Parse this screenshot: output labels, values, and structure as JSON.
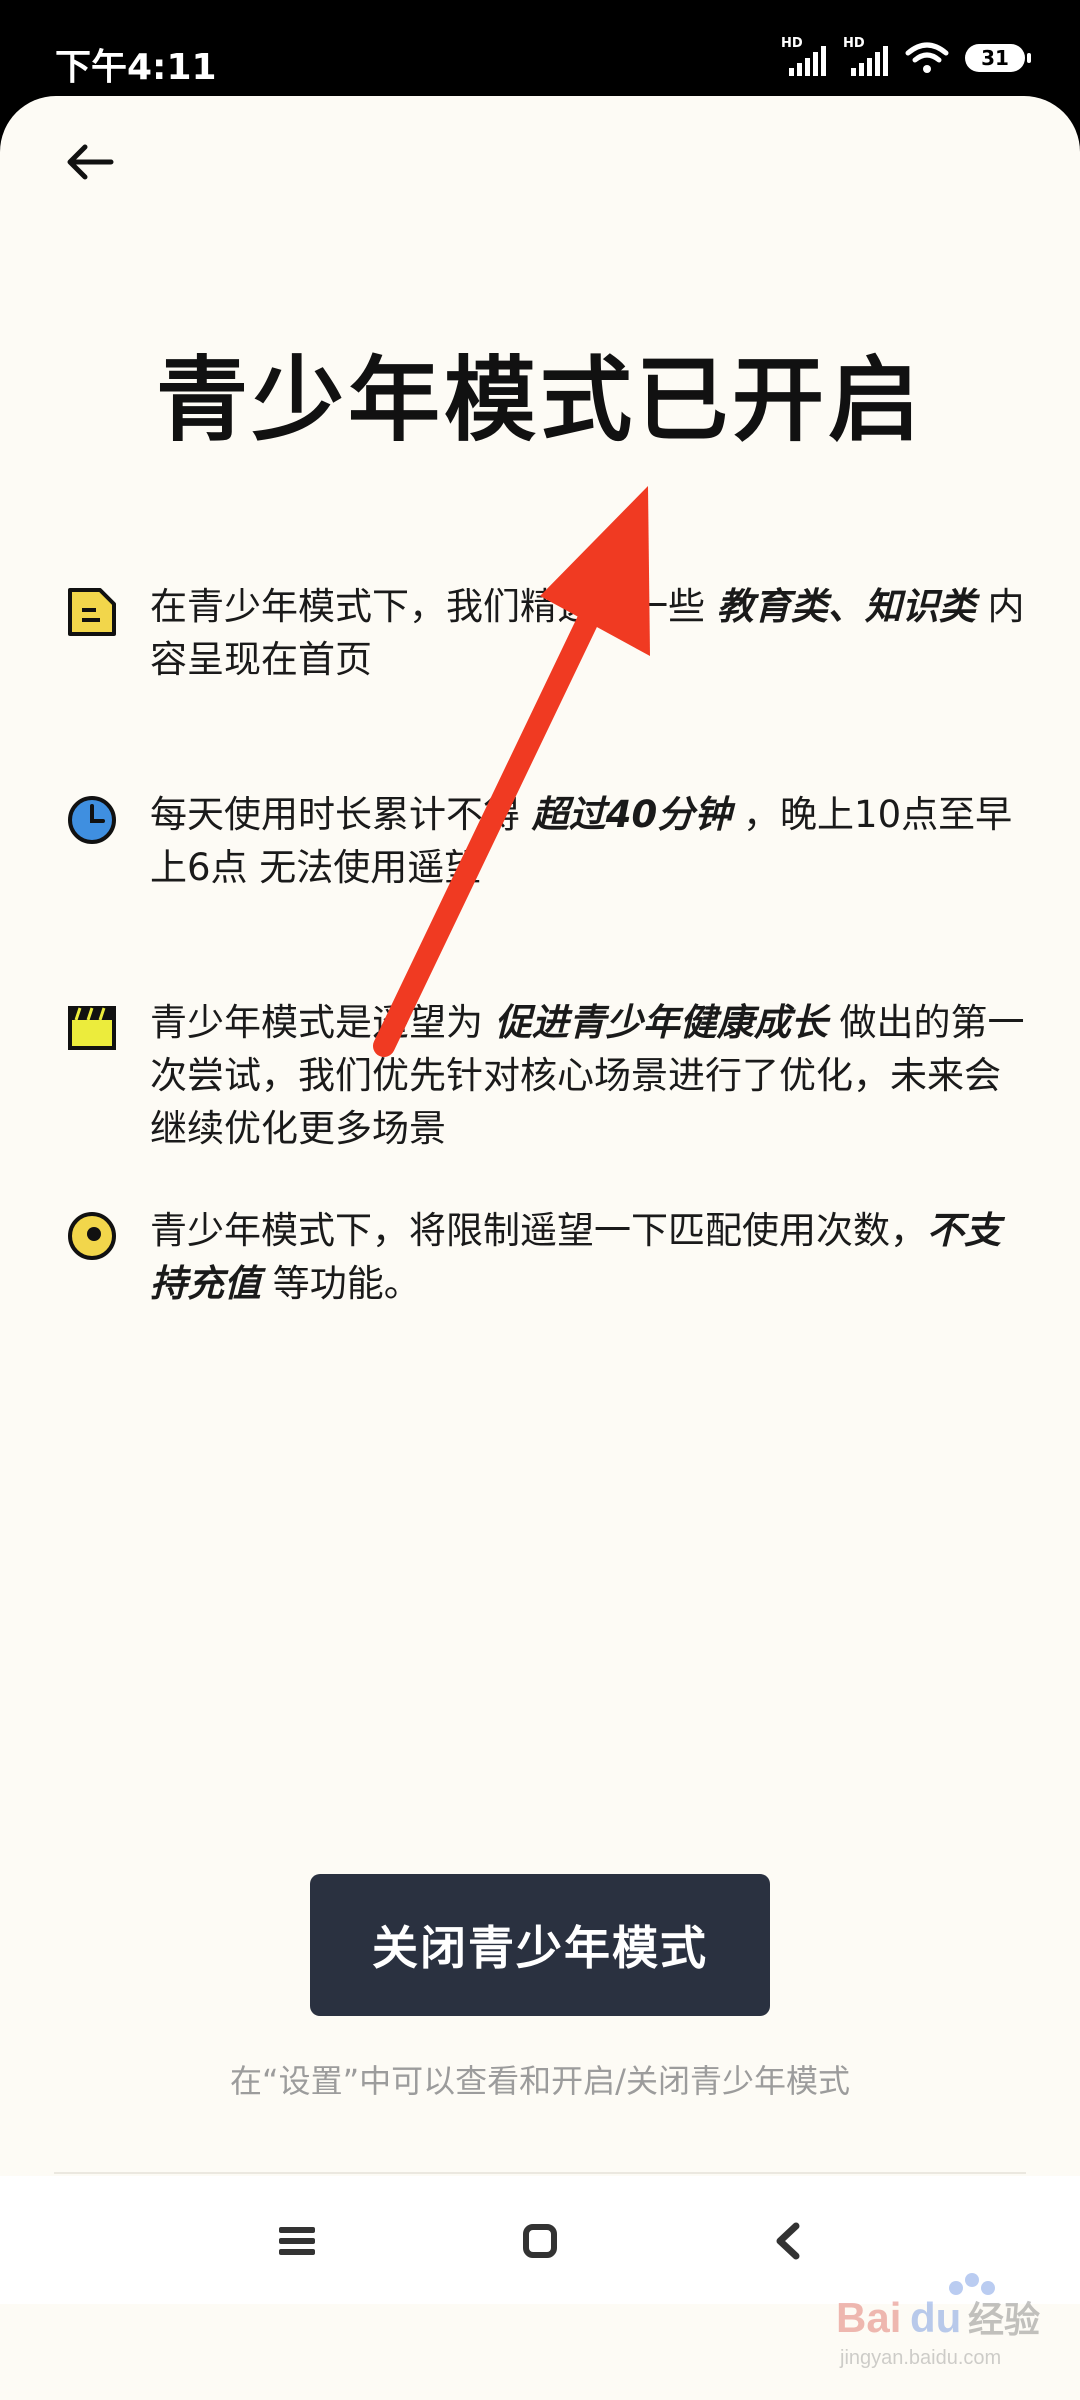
{
  "status_bar": {
    "time": "下午4:11",
    "signal_label": "HD",
    "battery": "31"
  },
  "page": {
    "title": "青少年模式已开启",
    "items": [
      {
        "icon": "document-icon",
        "text_a": "在青少年模式下，我们精选了一些 ",
        "em_a": "教育类、知识类",
        "text_b": " 内容呈现在首页",
        "em_b": "",
        "text_c": ""
      },
      {
        "icon": "clock-icon",
        "text_a": "每天使用时长累计不得 ",
        "em_a": "超过40分钟",
        "text_b": " ，晚上10点至早上6点 无法使用遥望",
        "em_b": "",
        "text_c": ""
      },
      {
        "icon": "clapperboard-icon",
        "text_a": "青少年模式是遥望为 ",
        "em_a": "促进青少年健康成长",
        "text_b": " 做出的第一次尝试，我们优先针对核心场景进行了优化，未来会继续优化更多场景",
        "em_b": "",
        "text_c": ""
      },
      {
        "icon": "coin-icon",
        "text_a": "青少年模式下，将限制遥望一下匹配使用次数，",
        "em_a": "不支持充值",
        "text_b": " 等功能。",
        "em_b": "",
        "text_c": ""
      }
    ],
    "close_button": "关闭青少年模式",
    "hint": "在“设置”中可以查看和开启/关闭青少年模式"
  },
  "nav_bar": {
    "menu_icon": "menu-icon",
    "home_icon": "home-icon",
    "back_icon": "back-icon"
  },
  "watermark": {
    "brand": "Bai",
    "brand2": "du",
    "sub": "经验",
    "url": "jingyan.baidu.com"
  },
  "colors": {
    "sheet_bg": "#fdfbf5",
    "button_bg": "#2a3140",
    "accent_yellow": "#f2d64b",
    "accent_blue": "#3f8fe0",
    "arrow_red": "#f03a22"
  }
}
